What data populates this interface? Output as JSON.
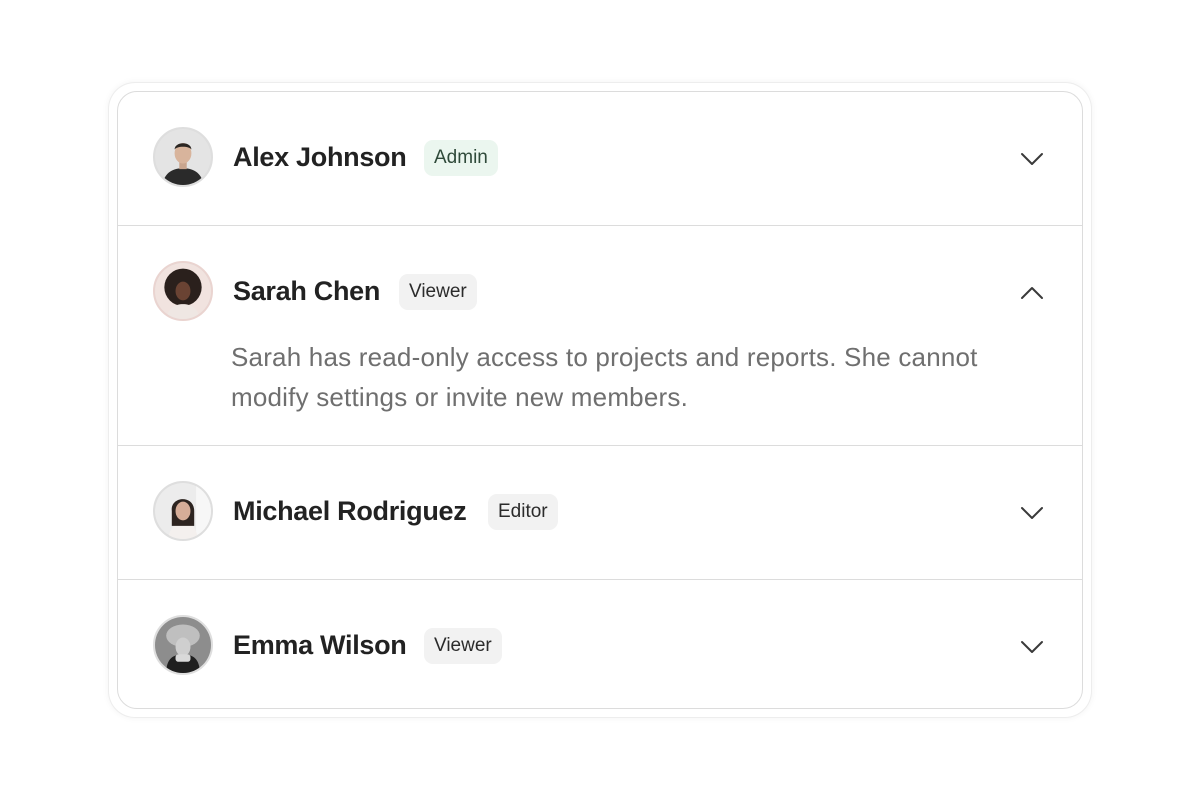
{
  "members": [
    {
      "name": "Alex Johnson",
      "role": "Admin",
      "expanded": false,
      "description": "",
      "avatar_icon": "avatar-photo"
    },
    {
      "name": "Sarah Chen",
      "role": "Viewer",
      "expanded": true,
      "description": "Sarah has read-only access to projects and reports. She cannot modify settings or invite new members.",
      "avatar_icon": "avatar-photo"
    },
    {
      "name": "Michael Rodriguez",
      "role": "Editor",
      "expanded": false,
      "description": "",
      "avatar_icon": "avatar-photo"
    },
    {
      "name": "Emma Wilson",
      "role": "Viewer",
      "expanded": false,
      "description": "",
      "avatar_icon": "avatar-photo"
    }
  ],
  "icons": {
    "collapsed": "chevron-down-icon",
    "expanded": "chevron-up-icon"
  },
  "colors": {
    "admin_badge_bg": "#ebf6ef",
    "badge_bg": "#f2f2f2",
    "border": "#dcdcdc",
    "name_text": "#222222",
    "description_text": "#6f6f6f"
  }
}
